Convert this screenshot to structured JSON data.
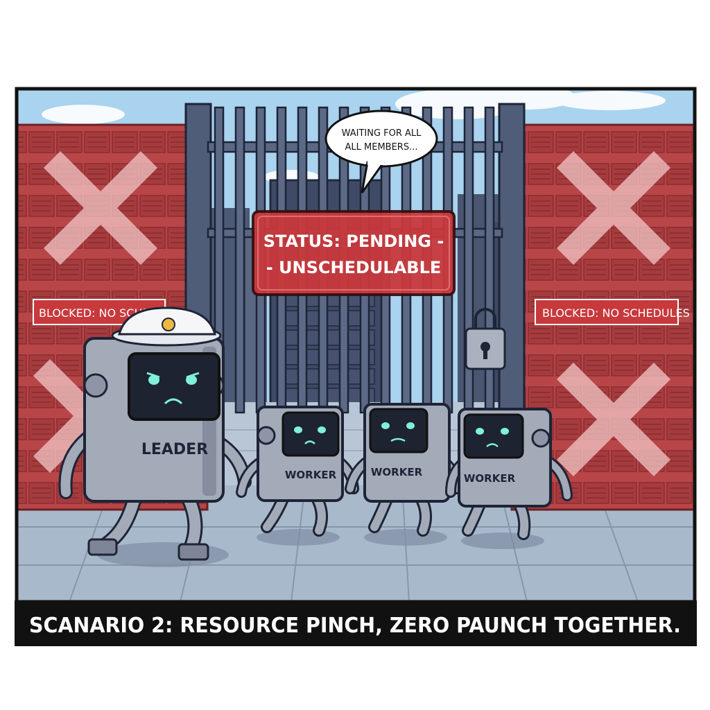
{
  "bubble": {
    "line1": "WAITING FOR ALL",
    "line2": "ALL MEMBERS..."
  },
  "status_sign": {
    "line1": "STATUS: PENDING -",
    "line2": "- UNSCHEDULABLE"
  },
  "left_rack": {
    "banner": "BLOCKED: NO SCHEDULE"
  },
  "right_rack": {
    "banner": "BLOCKED: NO SCHEDULES"
  },
  "robots": {
    "leader": {
      "label": "LEADER"
    },
    "worker1": {
      "label": "WORKER"
    },
    "worker2": {
      "label": "WORKER"
    },
    "worker3": {
      "label": "WORKER"
    }
  },
  "caption": {
    "text": "SCANARIO 2: RESOURCE PINCH,  ZERO PAUNCH TOGETHER."
  },
  "colors": {
    "rack_red": "#b84547",
    "sign_red": "#c8393c",
    "sky": "#a9d3ee",
    "floor": "#a9b9cc",
    "robot_body": "#a3aab8",
    "screen": "#1d2330",
    "eyes": "#7ff0dc",
    "caption_bg": "#111111"
  }
}
